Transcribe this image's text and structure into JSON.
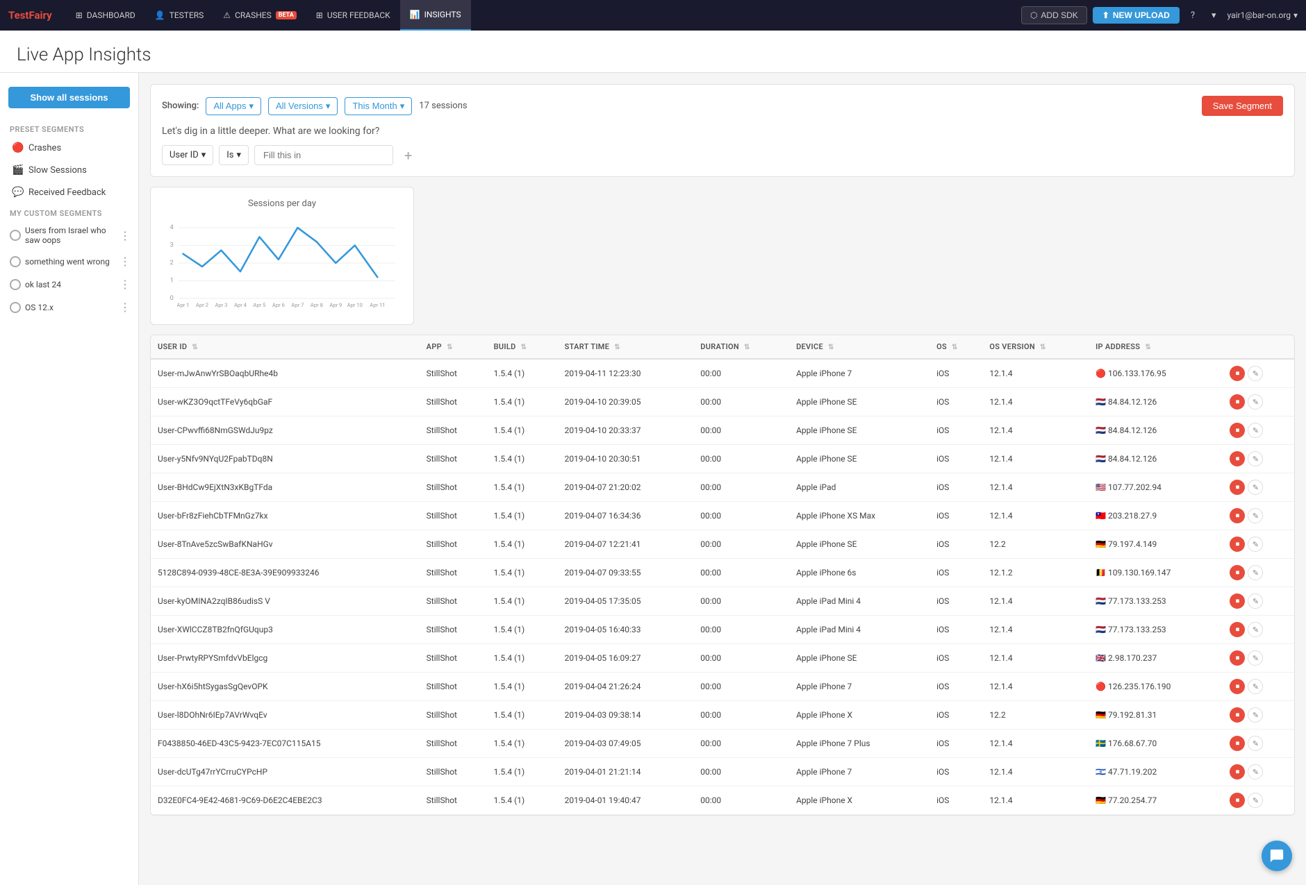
{
  "brand": {
    "text": "Test",
    "highlight": "Fairy"
  },
  "nav": {
    "items": [
      {
        "id": "dashboard",
        "label": "DASHBOARD",
        "icon": "⊞",
        "active": false
      },
      {
        "id": "testers",
        "label": "TESTERS",
        "icon": "👤",
        "active": false
      },
      {
        "id": "crashes",
        "label": "CRASHES",
        "icon": "⚠",
        "active": false,
        "badge": "BETA"
      },
      {
        "id": "user-feedback",
        "label": "USER FEEDBACK",
        "icon": "⊞",
        "active": false
      },
      {
        "id": "insights",
        "label": "INSIGHTS",
        "icon": "📊",
        "active": true
      }
    ],
    "add_sdk_label": "ADD SDK",
    "new_upload_label": "NEW UPLOAD",
    "help_label": "?",
    "user_label": "yair1@bar-on.org"
  },
  "page": {
    "title": "Live App Insights"
  },
  "sidebar": {
    "show_all_btn": "Show all sessions",
    "preset_section": "Preset Segments",
    "preset_items": [
      {
        "id": "crashes",
        "label": "Crashes",
        "icon": "🔴"
      },
      {
        "id": "slow-sessions",
        "label": "Slow Sessions",
        "icon": "🎬"
      },
      {
        "id": "received-feedback",
        "label": "Received Feedback",
        "icon": "💬"
      }
    ],
    "custom_section": "My Custom Segments",
    "custom_items": [
      {
        "id": "israel-oops",
        "label": "Users from Israel who saw oops"
      },
      {
        "id": "something-wrong",
        "label": "something went wrong"
      },
      {
        "id": "ok-last-24",
        "label": "ok last 24"
      },
      {
        "id": "os-12x",
        "label": "OS 12.x"
      }
    ]
  },
  "filter": {
    "showing_label": "Showing:",
    "app_filter": "All Apps",
    "version_filter": "All Versions",
    "time_filter": "This Month",
    "session_count": "17 sessions",
    "question": "Let's dig in a little deeper. What are we looking for?",
    "save_segment_btn": "Save Segment",
    "user_id_label": "User ID",
    "is_label": "Is",
    "fill_placeholder": "Fill this in"
  },
  "chart": {
    "title": "Sessions per day",
    "x_labels": [
      "Apr 1",
      "Apr 2",
      "Apr 3",
      "Apr 4",
      "Apr 5",
      "Apr 6",
      "Apr 7",
      "Apr 8",
      "Apr 9",
      "Apr 10",
      "Apr 11"
    ],
    "y_labels": [
      "0",
      "1",
      "2",
      "3",
      "4"
    ],
    "points": [
      [
        0,
        2.5
      ],
      [
        1,
        1.8
      ],
      [
        2,
        2.8
      ],
      [
        3,
        1.5
      ],
      [
        4,
        3.5
      ],
      [
        5,
        2.2
      ],
      [
        6,
        4.0
      ],
      [
        7,
        3.2
      ],
      [
        8,
        2.0
      ],
      [
        9,
        3.0
      ],
      [
        10,
        1.2
      ]
    ]
  },
  "table": {
    "columns": [
      {
        "id": "user-id",
        "label": "USER ID"
      },
      {
        "id": "app",
        "label": "APP"
      },
      {
        "id": "build",
        "label": "BUILD"
      },
      {
        "id": "start-time",
        "label": "START TIME"
      },
      {
        "id": "duration",
        "label": "DURATION"
      },
      {
        "id": "device",
        "label": "DEVICE"
      },
      {
        "id": "os",
        "label": "OS"
      },
      {
        "id": "os-version",
        "label": "OS VERSION"
      },
      {
        "id": "ip-address",
        "label": "IP ADDRESS"
      }
    ],
    "rows": [
      {
        "user_id": "User-mJwAnwYrSBOaqbURhe4b",
        "app": "StillShot",
        "build": "1.5.4 (1)",
        "start_time": "2019-04-11 12:23:30",
        "duration": "00:00",
        "device": "Apple iPhone 7",
        "os": "iOS",
        "os_version": "12.1.4",
        "ip_flag": "🔴",
        "ip": "106.133.176.95"
      },
      {
        "user_id": "User-wKZ3O9qctTFeVy6qbGaF",
        "app": "StillShot",
        "build": "1.5.4 (1)",
        "start_time": "2019-04-10 20:39:05",
        "duration": "00:00",
        "device": "Apple iPhone SE",
        "os": "iOS",
        "os_version": "12.1.4",
        "ip_flag": "🇳🇱",
        "ip": "84.84.12.126"
      },
      {
        "user_id": "User-CPwvffi68NmGSWdJu9pz",
        "app": "StillShot",
        "build": "1.5.4 (1)",
        "start_time": "2019-04-10 20:33:37",
        "duration": "00:00",
        "device": "Apple iPhone SE",
        "os": "iOS",
        "os_version": "12.1.4",
        "ip_flag": "🇳🇱",
        "ip": "84.84.12.126"
      },
      {
        "user_id": "User-y5Nfv9NYqU2FpabTDq8N",
        "app": "StillShot",
        "build": "1.5.4 (1)",
        "start_time": "2019-04-10 20:30:51",
        "duration": "00:00",
        "device": "Apple iPhone SE",
        "os": "iOS",
        "os_version": "12.1.4",
        "ip_flag": "🇳🇱",
        "ip": "84.84.12.126"
      },
      {
        "user_id": "User-BHdCw9EjXtN3xKBgTFda",
        "app": "StillShot",
        "build": "1.5.4 (1)",
        "start_time": "2019-04-07 21:20:02",
        "duration": "00:00",
        "device": "Apple iPad",
        "os": "iOS",
        "os_version": "12.1.4",
        "ip_flag": "🇺🇸",
        "ip": "107.77.202.94"
      },
      {
        "user_id": "User-bFr8zFiehCbTFMnGz7kx",
        "app": "StillShot",
        "build": "1.5.4 (1)",
        "start_time": "2019-04-07 16:34:36",
        "duration": "00:00",
        "device": "Apple iPhone XS Max",
        "os": "iOS",
        "os_version": "12.1.4",
        "ip_flag": "🇹🇼",
        "ip": "203.218.27.9"
      },
      {
        "user_id": "User-8TnAve5zcSwBafKNaHGv",
        "app": "StillShot",
        "build": "1.5.4 (1)",
        "start_time": "2019-04-07 12:21:41",
        "duration": "00:00",
        "device": "Apple iPhone SE",
        "os": "iOS",
        "os_version": "12.2",
        "ip_flag": "🇩🇪",
        "ip": "79.197.4.149"
      },
      {
        "user_id": "5128C894-0939-48CE-8E3A-39E909933246",
        "app": "StillShot",
        "build": "1.5.4 (1)",
        "start_time": "2019-04-07 09:33:55",
        "duration": "00:00",
        "device": "Apple iPhone 6s",
        "os": "iOS",
        "os_version": "12.1.2",
        "ip_flag": "🇧🇪",
        "ip": "109.130.169.147"
      },
      {
        "user_id": "User-kyOMINA2zqIB86udisS V",
        "app": "StillShot",
        "build": "1.5.4 (1)",
        "start_time": "2019-04-05 17:35:05",
        "duration": "00:00",
        "device": "Apple iPad Mini 4",
        "os": "iOS",
        "os_version": "12.1.4",
        "ip_flag": "🇳🇱",
        "ip": "77.173.133.253"
      },
      {
        "user_id": "User-XWlCCZ8TB2fnQfGUqup3",
        "app": "StillShot",
        "build": "1.5.4 (1)",
        "start_time": "2019-04-05 16:40:33",
        "duration": "00:00",
        "device": "Apple iPad Mini 4",
        "os": "iOS",
        "os_version": "12.1.4",
        "ip_flag": "🇳🇱",
        "ip": "77.173.133.253"
      },
      {
        "user_id": "User-PrwtyRPYSmfdvVbElgcg",
        "app": "StillShot",
        "build": "1.5.4 (1)",
        "start_time": "2019-04-05 16:09:27",
        "duration": "00:00",
        "device": "Apple iPhone SE",
        "os": "iOS",
        "os_version": "12.1.4",
        "ip_flag": "🇬🇧",
        "ip": "2.98.170.237"
      },
      {
        "user_id": "User-hX6i5htSygasSgQevOPK",
        "app": "StillShot",
        "build": "1.5.4 (1)",
        "start_time": "2019-04-04 21:26:24",
        "duration": "00:00",
        "device": "Apple iPhone 7",
        "os": "iOS",
        "os_version": "12.1.4",
        "ip_flag": "🔴",
        "ip": "126.235.176.190"
      },
      {
        "user_id": "User-l8DOhNr6IEp7AVrWvqEv",
        "app": "StillShot",
        "build": "1.5.4 (1)",
        "start_time": "2019-04-03 09:38:14",
        "duration": "00:00",
        "device": "Apple iPhone X",
        "os": "iOS",
        "os_version": "12.2",
        "ip_flag": "🇩🇪",
        "ip": "79.192.81.31"
      },
      {
        "user_id": "F0438850-46ED-43C5-9423-7EC07C115A15",
        "app": "StillShot",
        "build": "1.5.4 (1)",
        "start_time": "2019-04-03 07:49:05",
        "duration": "00:00",
        "device": "Apple iPhone 7 Plus",
        "os": "iOS",
        "os_version": "12.1.4",
        "ip_flag": "🇸🇪",
        "ip": "176.68.67.70"
      },
      {
        "user_id": "User-dcUTg47rrYCrruCYPcHP",
        "app": "StillShot",
        "build": "1.5.4 (1)",
        "start_time": "2019-04-01 21:21:14",
        "duration": "00:00",
        "device": "Apple iPhone 7",
        "os": "iOS",
        "os_version": "12.1.4",
        "ip_flag": "🇮🇱",
        "ip": "47.71.19.202"
      },
      {
        "user_id": "D32E0FC4-9E42-4681-9C69-D6E2C4EBE2C3",
        "app": "StillShot",
        "build": "1.5.4 (1)",
        "start_time": "2019-04-01 19:40:47",
        "duration": "00:00",
        "device": "Apple iPhone X",
        "os": "iOS",
        "os_version": "12.1.4",
        "ip_flag": "🇩🇪",
        "ip": "77.20.254.77"
      }
    ]
  }
}
